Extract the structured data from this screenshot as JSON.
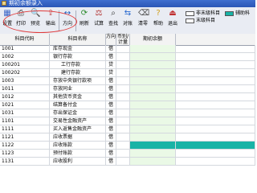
{
  "window": {
    "title": "期初余额录入"
  },
  "toolbar": {
    "buttons": [
      {
        "id": "settings",
        "label": "设置",
        "icon": "settings-icon"
      },
      {
        "id": "print",
        "label": "打印",
        "icon": "print-icon"
      },
      {
        "id": "preview",
        "label": "预览",
        "icon": "preview-icon"
      },
      {
        "id": "export",
        "label": "输出",
        "icon": "export-icon"
      },
      {
        "id": "direction",
        "label": "方向",
        "icon": "direction-icon"
      },
      {
        "id": "refresh",
        "label": "刷新",
        "icon": "refresh-icon"
      },
      {
        "id": "trial",
        "label": "试算",
        "icon": "trial-balance-icon"
      },
      {
        "id": "find",
        "label": "查找",
        "icon": "find-icon"
      },
      {
        "id": "reconcile",
        "label": "对账",
        "icon": "reconcile-icon"
      },
      {
        "id": "clear",
        "label": "清零",
        "icon": "clear-icon"
      },
      {
        "id": "help",
        "label": "帮助",
        "icon": "help-icon"
      },
      {
        "id": "exit",
        "label": "退出",
        "icon": "exit-icon"
      }
    ]
  },
  "legend": {
    "items": [
      {
        "label": "非末级科目",
        "color": "#ffffff"
      },
      {
        "label": "末级科目",
        "color": "#ffffff"
      },
      {
        "label": "辅助科",
        "color": "#19b3a6"
      }
    ]
  },
  "table": {
    "headers": {
      "code": "科目代码",
      "name": "科目名称",
      "direction": "方向",
      "currency": "币别/计量",
      "balance": "期初余额"
    },
    "rows": [
      {
        "code": "1001",
        "name": "库存现金",
        "direction": "借",
        "indent": 0,
        "aux": false
      },
      {
        "code": "1002",
        "name": "银行存款",
        "direction": "借",
        "indent": 0,
        "aux": false
      },
      {
        "code": "100201",
        "name": "工行存款",
        "direction": "贷",
        "indent": 1,
        "aux": false
      },
      {
        "code": "100202",
        "name": "建行存款",
        "direction": "贷",
        "indent": 1,
        "aux": false
      },
      {
        "code": "1003",
        "name": "存放中央银行款项",
        "direction": "借",
        "indent": 0,
        "aux": false
      },
      {
        "code": "1011",
        "name": "存放同业",
        "direction": "借",
        "indent": 0,
        "aux": false
      },
      {
        "code": "1012",
        "name": "其他货币资金",
        "direction": "借",
        "indent": 0,
        "aux": false
      },
      {
        "code": "1021",
        "name": "结算备付金",
        "direction": "借",
        "indent": 0,
        "aux": false
      },
      {
        "code": "1031",
        "name": "存出保证金",
        "direction": "借",
        "indent": 0,
        "aux": false
      },
      {
        "code": "1101",
        "name": "交易性金融资产",
        "direction": "借",
        "indent": 0,
        "aux": false
      },
      {
        "code": "1111",
        "name": "买入返售金融资产",
        "direction": "借",
        "indent": 0,
        "aux": false
      },
      {
        "code": "1121",
        "name": "应收票据",
        "direction": "借",
        "indent": 0,
        "aux": false
      },
      {
        "code": "1122",
        "name": "应收账款",
        "direction": "借",
        "indent": 0,
        "aux": true
      },
      {
        "code": "1123",
        "name": "预付账款",
        "direction": "借",
        "indent": 0,
        "aux": false
      },
      {
        "code": "1131",
        "name": "应收股利",
        "direction": "借",
        "indent": 0,
        "aux": false
      }
    ]
  }
}
